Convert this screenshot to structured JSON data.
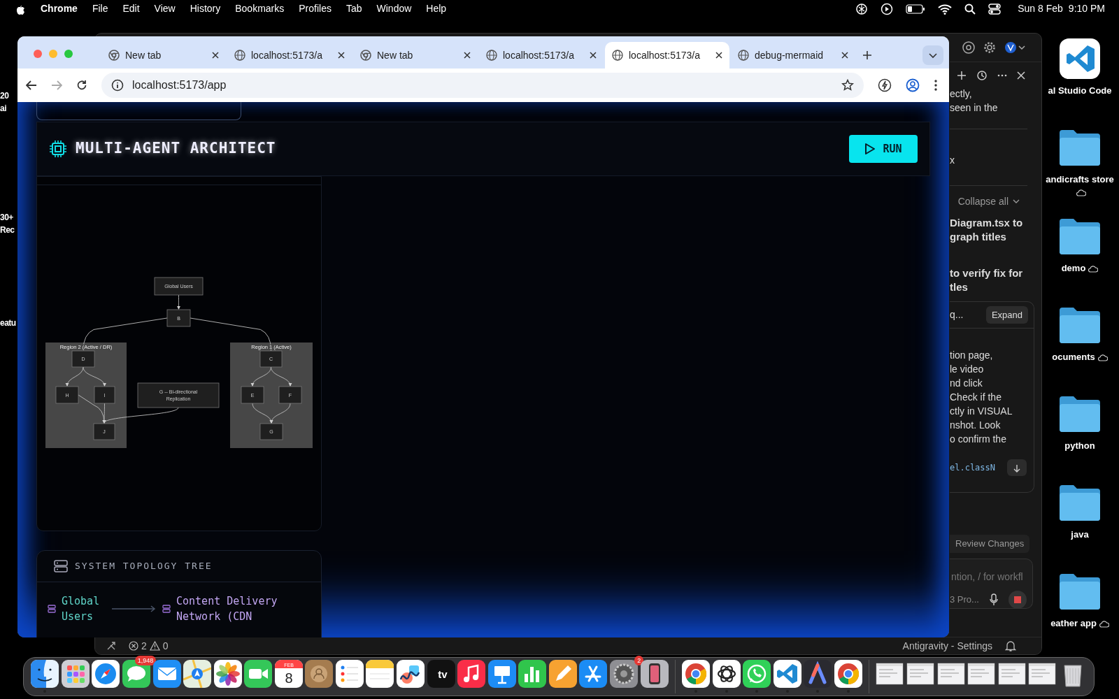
{
  "menu_bar": {
    "app": "Chrome",
    "items": [
      "File",
      "Edit",
      "View",
      "History",
      "Bookmarks",
      "Profiles",
      "Tab",
      "Window",
      "Help"
    ],
    "date": "Sun 8 Feb",
    "time": "9:10 PM"
  },
  "desktop_left_labels": [
    {
      "lines": [
        "20",
        "ai"
      ]
    },
    {
      "lines": [
        "30+",
        "Rec"
      ]
    },
    {
      "lines": [
        "eatu"
      ]
    }
  ],
  "desktop_icons": [
    {
      "label": "al Studio Code",
      "kind": "app",
      "cloud": false
    },
    {
      "label": "andicrafts store",
      "kind": "folder",
      "cloud": true
    },
    {
      "label": "demo",
      "kind": "folder",
      "cloud": true
    },
    {
      "label": "ocuments",
      "kind": "folder",
      "cloud": true
    },
    {
      "label": "python",
      "kind": "folder",
      "cloud": false
    },
    {
      "label": "java",
      "kind": "folder",
      "cloud": false
    },
    {
      "label": "eather app",
      "kind": "folder",
      "cloud": true
    }
  ],
  "editor_window": {
    "message_1": [
      "ectly,",
      "seen in the"
    ],
    "message_2": [
      "x"
    ],
    "collapse_label": "Collapse all",
    "step_1": [
      "Diagram.tsx to",
      "graph titles"
    ],
    "step_2": [
      "to verify fix for",
      "tles"
    ],
    "task_card": {
      "title": "q...",
      "expand_button": "Expand",
      "body": [
        "tion page,",
        "le video",
        "nd click",
        "Check if the",
        "ctly in VISUAL",
        "nshot. Look",
        "o confirm the"
      ],
      "code": "el.classN"
    },
    "review_button": "Review Changes",
    "input": {
      "placeholder": "ntion, / for workfl"
    },
    "model": "3 Pro...",
    "status_bar": {
      "errors": "2",
      "warnings": "0",
      "settings_label": "Antigravity - Settings"
    }
  },
  "browser": {
    "tabs": [
      {
        "title": "New tab",
        "kind": "newtab",
        "selected": false
      },
      {
        "title": "localhost:5173/a",
        "kind": "page",
        "selected": false
      },
      {
        "title": "New tab",
        "kind": "newtab",
        "selected": false
      },
      {
        "title": "localhost:5173/a",
        "kind": "page",
        "selected": false
      },
      {
        "title": "localhost:5173/a",
        "kind": "page",
        "selected": true
      },
      {
        "title": "debug-mermaid",
        "kind": "page",
        "selected": false
      }
    ],
    "address": "localhost:5173/app"
  },
  "app": {
    "title": "MULTI-AGENT ARCHITECT",
    "run_button": "RUN",
    "diagram": {
      "groups": [
        {
          "label": "Region 2 (Active / DR)"
        },
        {
          "label": "Region 1 (Active)"
        }
      ],
      "nodes": [
        {
          "lines": [
            "Global Users"
          ]
        },
        {
          "lines": [
            "B"
          ]
        },
        {
          "lines": [
            "D"
          ]
        },
        {
          "lines": [
            "H"
          ]
        },
        {
          "lines": [
            "I"
          ]
        },
        {
          "lines": [
            "J"
          ]
        },
        {
          "lines": [
            "G -- Bi-directional",
            "Replication"
          ]
        },
        {
          "lines": [
            "C"
          ]
        },
        {
          "lines": [
            "E"
          ]
        },
        {
          "lines": [
            "F"
          ]
        },
        {
          "lines": [
            "G"
          ]
        }
      ]
    },
    "tree": {
      "title": "SYSTEM TOPOLOGY TREE",
      "nodes": [
        {
          "label": "Global Users",
          "color": "#5fd4c8"
        },
        {
          "label": "Content Delivery Network (CDN",
          "color": "#c2a6f2"
        }
      ]
    }
  },
  "dock": [
    {
      "kind": "finder",
      "running": true
    },
    {
      "kind": "launchpad",
      "running": false
    },
    {
      "kind": "safari",
      "running": false
    },
    {
      "kind": "messages",
      "running": false,
      "badge": "1,948"
    },
    {
      "kind": "mail",
      "running": false
    },
    {
      "kind": "maps",
      "running": false
    },
    {
      "kind": "photos",
      "running": false
    },
    {
      "kind": "facetime",
      "running": false
    },
    {
      "kind": "calendar",
      "running": false,
      "text": [
        "FEB",
        "8"
      ]
    },
    {
      "kind": "contacts",
      "running": false
    },
    {
      "kind": "reminders",
      "running": false
    },
    {
      "kind": "notes",
      "running": false
    },
    {
      "kind": "freeform",
      "running": false
    },
    {
      "kind": "tv",
      "running": false,
      "text": [
        "tv"
      ]
    },
    {
      "kind": "music",
      "running": false
    },
    {
      "kind": "keynote",
      "running": false
    },
    {
      "kind": "numbers",
      "running": false
    },
    {
      "kind": "pages",
      "running": false
    },
    {
      "kind": "appstore",
      "running": false
    },
    {
      "kind": "settings",
      "running": false,
      "badge": "2"
    },
    {
      "kind": "phone",
      "running": false
    },
    {
      "kind": "separator"
    },
    {
      "kind": "chrome",
      "running": true
    },
    {
      "kind": "chatgpt",
      "running": true
    },
    {
      "kind": "whatsapp",
      "running": true
    },
    {
      "kind": "vscode",
      "running": true
    },
    {
      "kind": "arc",
      "running": true
    },
    {
      "kind": "chrome",
      "running": true
    },
    {
      "kind": "separator"
    },
    {
      "kind": "thumbnail",
      "running": false
    },
    {
      "kind": "thumbnail",
      "running": false
    },
    {
      "kind": "thumbnail",
      "running": false
    },
    {
      "kind": "thumbnail",
      "running": false
    },
    {
      "kind": "thumbnail",
      "running": false
    },
    {
      "kind": "thumbnail",
      "running": false
    },
    {
      "kind": "trash",
      "running": false
    }
  ]
}
